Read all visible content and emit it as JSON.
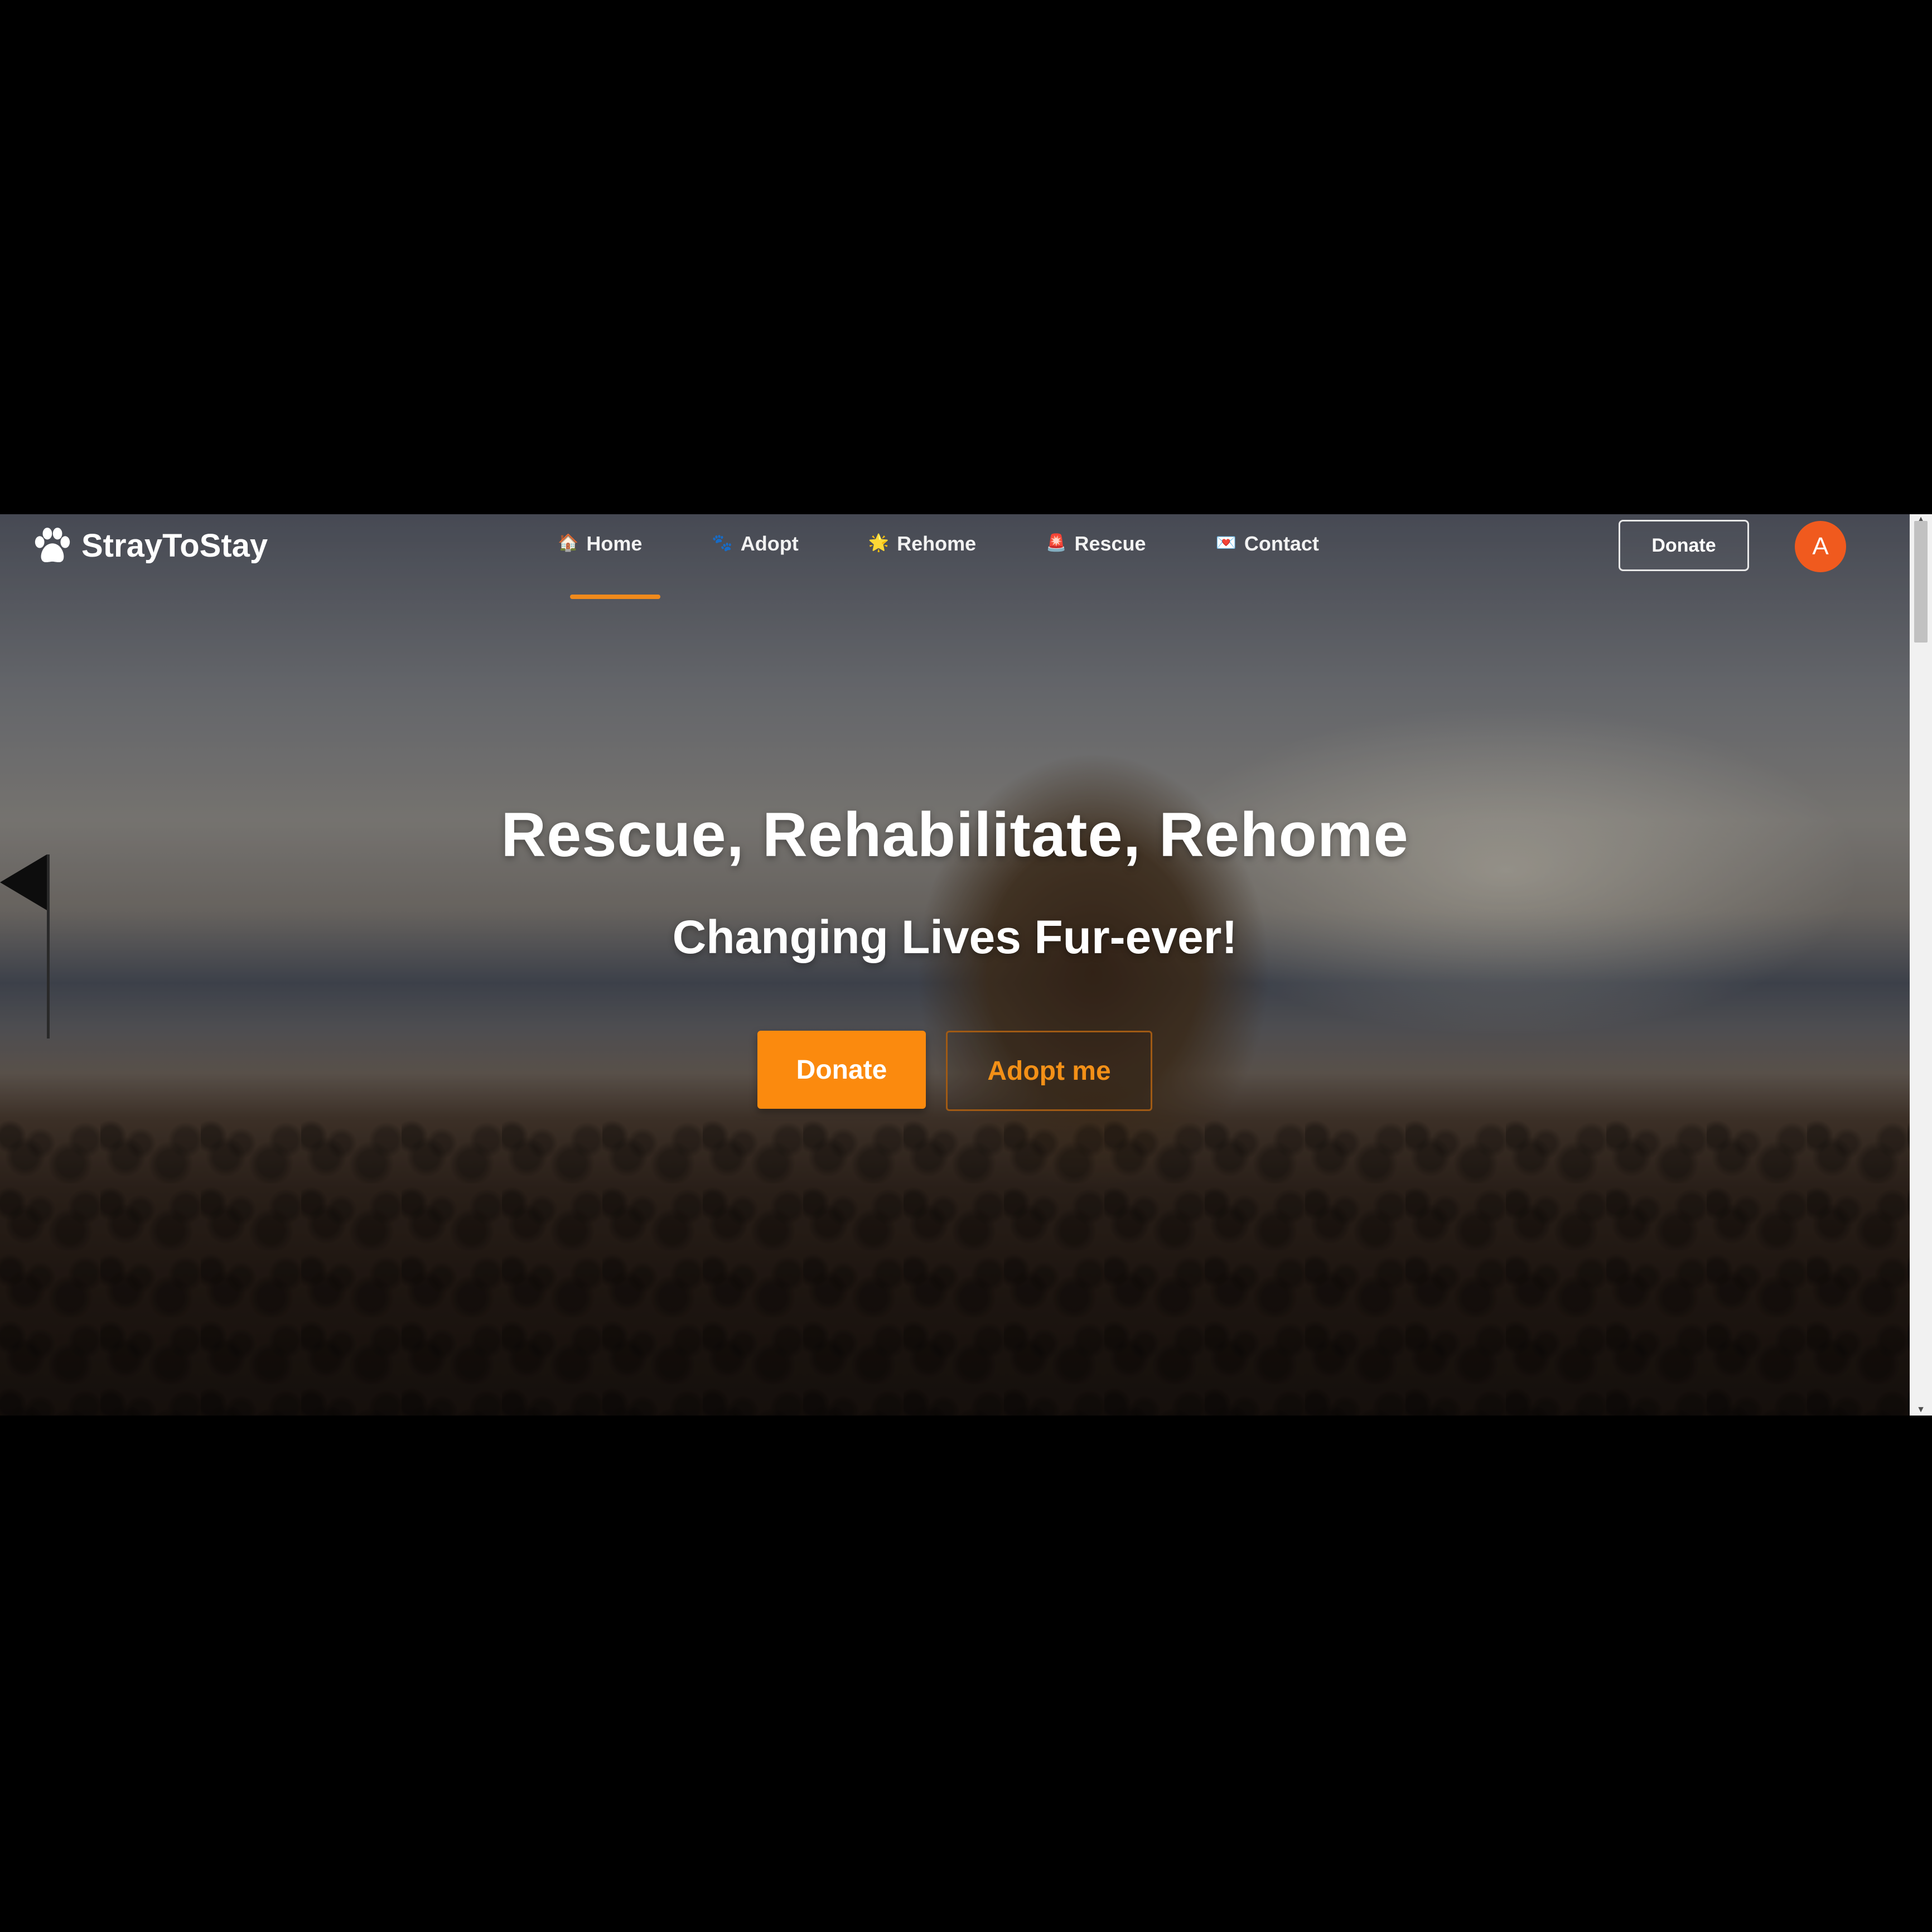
{
  "brand": {
    "name": "StrayToStay",
    "icon": "paw-icon"
  },
  "nav": {
    "items": [
      {
        "label": "Home",
        "icon": "🏠",
        "icon_name": "home-icon",
        "active": true
      },
      {
        "label": "Adopt",
        "icon": "🐾",
        "icon_name": "paw-prints-icon",
        "active": false
      },
      {
        "label": "Rehome",
        "icon": "🌟",
        "icon_name": "star-icon",
        "active": false
      },
      {
        "label": "Rescue",
        "icon": "🚨",
        "icon_name": "siren-icon",
        "active": false
      },
      {
        "label": "Contact",
        "icon": "💌",
        "icon_name": "love-letter-icon",
        "active": false
      }
    ],
    "donate_label": "Donate",
    "avatar_initial": "A"
  },
  "hero": {
    "title": "Rescue, Rehabilitate, Rehome",
    "subtitle": "Changing Lives Fur-ever!",
    "donate_label": "Donate",
    "adopt_label": "Adopt me"
  },
  "colors": {
    "accent": "#fb8a0e",
    "avatar": "#f05a1e",
    "active_underline": "#f08a1c"
  }
}
